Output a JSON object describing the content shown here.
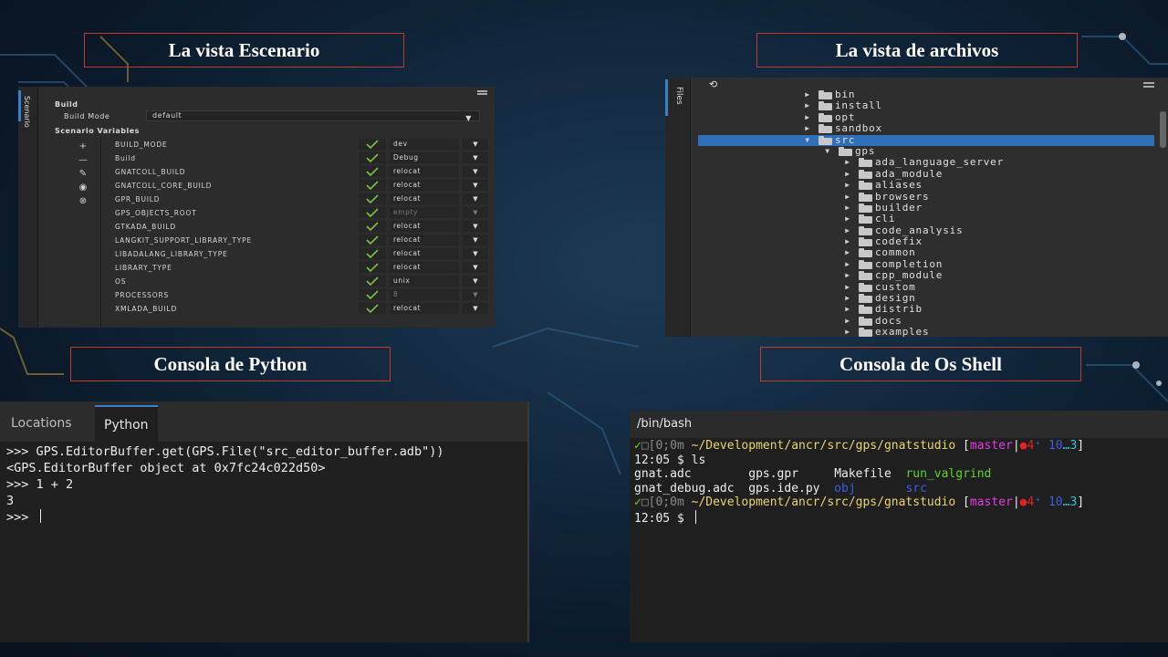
{
  "titles": {
    "escenario": "La vista Escenario",
    "archivos": "La vista de archivos",
    "python": "Consola de Python",
    "shell": "Consola de Os Shell"
  },
  "scenario": {
    "tab_label": "Scenario",
    "build_section": "Build",
    "build_mode_label": "Build Mode",
    "build_mode_value": "default",
    "variables_section": "Scenario Variables",
    "variables": [
      {
        "name": "BUILD_MODE",
        "value": "dev",
        "dim": false
      },
      {
        "name": "Build",
        "value": "Debug",
        "dim": false
      },
      {
        "name": "GNATCOLL_BUILD",
        "value": "relocat",
        "dim": false
      },
      {
        "name": "GNATCOLL_CORE_BUILD",
        "value": "relocat",
        "dim": false
      },
      {
        "name": "GPR_BUILD",
        "value": "relocat",
        "dim": false
      },
      {
        "name": "GPS_OBJECTS_ROOT",
        "value": "empty",
        "dim": true
      },
      {
        "name": "GTKADA_BUILD",
        "value": "relocat",
        "dim": false
      },
      {
        "name": "LANGKIT_SUPPORT_LIBRARY_TYPE",
        "value": "relocat",
        "dim": false
      },
      {
        "name": "LIBADALANG_LIBRARY_TYPE",
        "value": "relocat",
        "dim": false
      },
      {
        "name": "LIBRARY_TYPE",
        "value": "relocat",
        "dim": false
      },
      {
        "name": "OS",
        "value": "unix",
        "dim": false
      },
      {
        "name": "PROCESSORS",
        "value": "8",
        "dim": true
      },
      {
        "name": "XMLADA_BUILD",
        "value": "relocat",
        "dim": false
      }
    ]
  },
  "files": {
    "tab_label": "Files",
    "nodes": [
      {
        "label": "bin",
        "depth": 0,
        "expanded": false,
        "selected": false
      },
      {
        "label": "install",
        "depth": 0,
        "expanded": false,
        "selected": false
      },
      {
        "label": "opt",
        "depth": 0,
        "expanded": false,
        "selected": false
      },
      {
        "label": "sandbox",
        "depth": 0,
        "expanded": false,
        "selected": false
      },
      {
        "label": "src",
        "depth": 0,
        "expanded": true,
        "selected": true
      },
      {
        "label": "gps",
        "depth": 1,
        "expanded": true,
        "selected": false
      },
      {
        "label": "ada_language_server",
        "depth": 2,
        "expanded": false,
        "selected": false
      },
      {
        "label": "ada_module",
        "depth": 2,
        "expanded": false,
        "selected": false
      },
      {
        "label": "aliases",
        "depth": 2,
        "expanded": false,
        "selected": false
      },
      {
        "label": "browsers",
        "depth": 2,
        "expanded": false,
        "selected": false
      },
      {
        "label": "builder",
        "depth": 2,
        "expanded": false,
        "selected": false
      },
      {
        "label": "cli",
        "depth": 2,
        "expanded": false,
        "selected": false
      },
      {
        "label": "code_analysis",
        "depth": 2,
        "expanded": false,
        "selected": false
      },
      {
        "label": "codefix",
        "depth": 2,
        "expanded": false,
        "selected": false
      },
      {
        "label": "common",
        "depth": 2,
        "expanded": false,
        "selected": false
      },
      {
        "label": "completion",
        "depth": 2,
        "expanded": false,
        "selected": false
      },
      {
        "label": "cpp_module",
        "depth": 2,
        "expanded": false,
        "selected": false
      },
      {
        "label": "custom",
        "depth": 2,
        "expanded": false,
        "selected": false
      },
      {
        "label": "design",
        "depth": 2,
        "expanded": false,
        "selected": false
      },
      {
        "label": "distrib",
        "depth": 2,
        "expanded": false,
        "selected": false
      },
      {
        "label": "docs",
        "depth": 2,
        "expanded": false,
        "selected": false
      },
      {
        "label": "examples",
        "depth": 2,
        "expanded": false,
        "selected": false
      }
    ]
  },
  "python": {
    "tabs": [
      {
        "label": "Locations",
        "active": false
      },
      {
        "label": "Python",
        "active": true
      }
    ],
    "lines": [
      ">>> GPS.EditorBuffer.get(GPS.File(\"src_editor_buffer.adb\"))",
      "<GPS.EditorBuffer object at 0x7fc24c022d50>",
      ">>> 1 + 2",
      "3",
      ">>> "
    ]
  },
  "shell": {
    "tab_label": "/bin/bash",
    "prompt_check": "✓",
    "prompt_escape": "[0;0m",
    "prompt_path": "~/Development/ancr/src/gps/gnatstudio",
    "branch_open": "[",
    "branch": "master",
    "branch_sep": "|",
    "dot": "●",
    "modified": "4",
    "ahead": "3",
    "branch_close": "]",
    "time_prompt_1": "12:05 $ ls",
    "time_prompt_2": "12:05 $ ",
    "ls_row1": [
      "gnat.adc",
      "gps.gpr",
      "Makefile",
      "run_valgrind"
    ],
    "ls_row2": [
      "gnat_debug.adc",
      "gps.ide.py",
      "obj",
      "src"
    ]
  },
  "colors": {
    "accent": "#3d7ec9",
    "title_border": "#c0392b",
    "selected_row": "#2f6fb7"
  }
}
